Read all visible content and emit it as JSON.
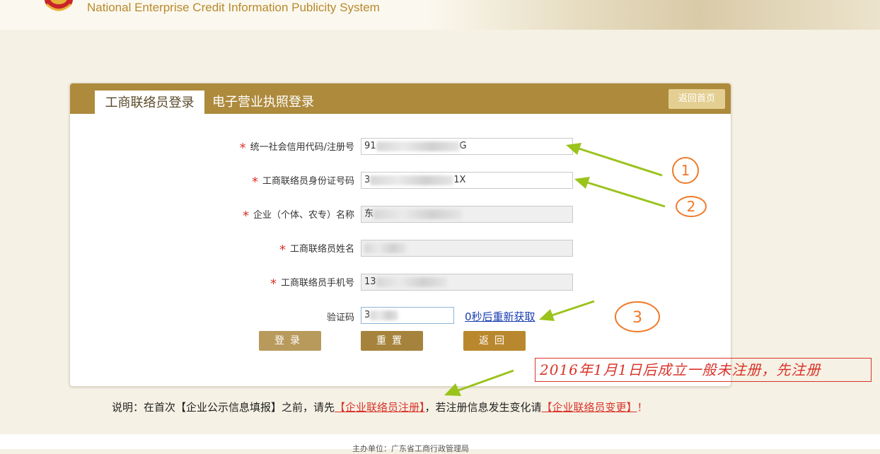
{
  "header": {
    "title": "National Enterprise Credit Information Publicity System"
  },
  "tabs": {
    "active": "工商联络员登录",
    "other": "电子营业执照登录",
    "home_button": "返回首页"
  },
  "form": {
    "fields": [
      {
        "label": "统一社会信用代码/注册号",
        "value_start": "91",
        "value_end": "G",
        "required": true
      },
      {
        "label": "工商联络员身份证号码",
        "value_start": "3",
        "value_end": "1X",
        "required": true
      },
      {
        "label": "企业（个体、农专）名称",
        "value_start": "东",
        "value_end": "",
        "required": true
      },
      {
        "label": "工商联络员姓名",
        "value_start": "",
        "value_end": "",
        "required": true
      },
      {
        "label": "工商联络员手机号",
        "value_start": "13",
        "value_end": "",
        "required": true
      }
    ],
    "captcha_label": "验证码",
    "captcha_value": "3",
    "resend": "0秒后重新获取",
    "required_mark": "*"
  },
  "buttons": {
    "login": "登录",
    "reset": "重置",
    "back": "返回"
  },
  "note": {
    "prefix": "说明：在首次【企业公示信息填报】之前，请先",
    "link1": "【企业联络员注册】",
    "middle": "，若注册信息发生变化请",
    "link2": "【企业联络员变更】",
    "suffix": "！"
  },
  "footer": {
    "text": "主办单位：广东省工商行政管理局"
  },
  "annotations": {
    "circle1": "1",
    "circle2": "2",
    "circle3": "3",
    "handwritten": "2016年1月1日后成立一般未注册，先注册"
  },
  "colors": {
    "brand_gold": "#ad8a3c",
    "annotation_red": "#d9342b",
    "annotation_orange": "#f07a2a",
    "arrow_green": "#9ac31c"
  }
}
